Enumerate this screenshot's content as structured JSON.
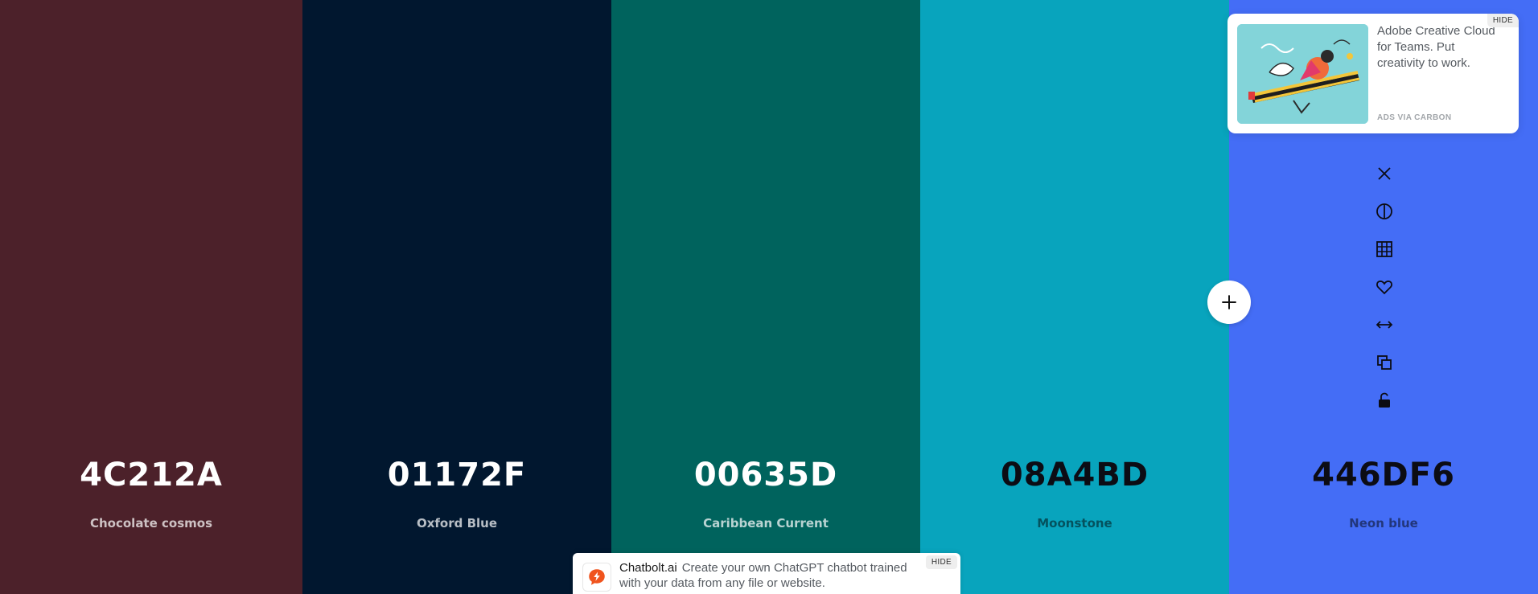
{
  "palette": {
    "colors": [
      {
        "hex": "4C212A",
        "name": "Chocolate cosmos",
        "bg": "#4C212A"
      },
      {
        "hex": "01172F",
        "name": "Oxford Blue",
        "bg": "#01172F"
      },
      {
        "hex": "00635D",
        "name": "Caribbean Current",
        "bg": "#00635D"
      },
      {
        "hex": "08A4BD",
        "name": "Moonstone",
        "bg": "#08A4BD"
      },
      {
        "hex": "446DF6",
        "name": "Neon blue",
        "bg": "#446DF6"
      }
    ]
  },
  "tools": [
    {
      "name": "close-icon"
    },
    {
      "name": "contrast-icon"
    },
    {
      "name": "shades-grid-icon"
    },
    {
      "name": "heart-icon"
    },
    {
      "name": "drag-arrows-icon"
    },
    {
      "name": "copy-icon"
    },
    {
      "name": "lock-icon"
    }
  ],
  "add_button": {
    "icon": "plus-icon"
  },
  "ad": {
    "text": "Adobe Creative Cloud for Teams. Put creativity to work.",
    "via": "ADS VIA CARBON",
    "hide": "HIDE"
  },
  "banner": {
    "brand": "Chatbolt.ai",
    "text": "Create your own ChatGPT chatbot trained with your data from any file or website.",
    "hide": "HIDE",
    "accent": "#f0541e"
  }
}
